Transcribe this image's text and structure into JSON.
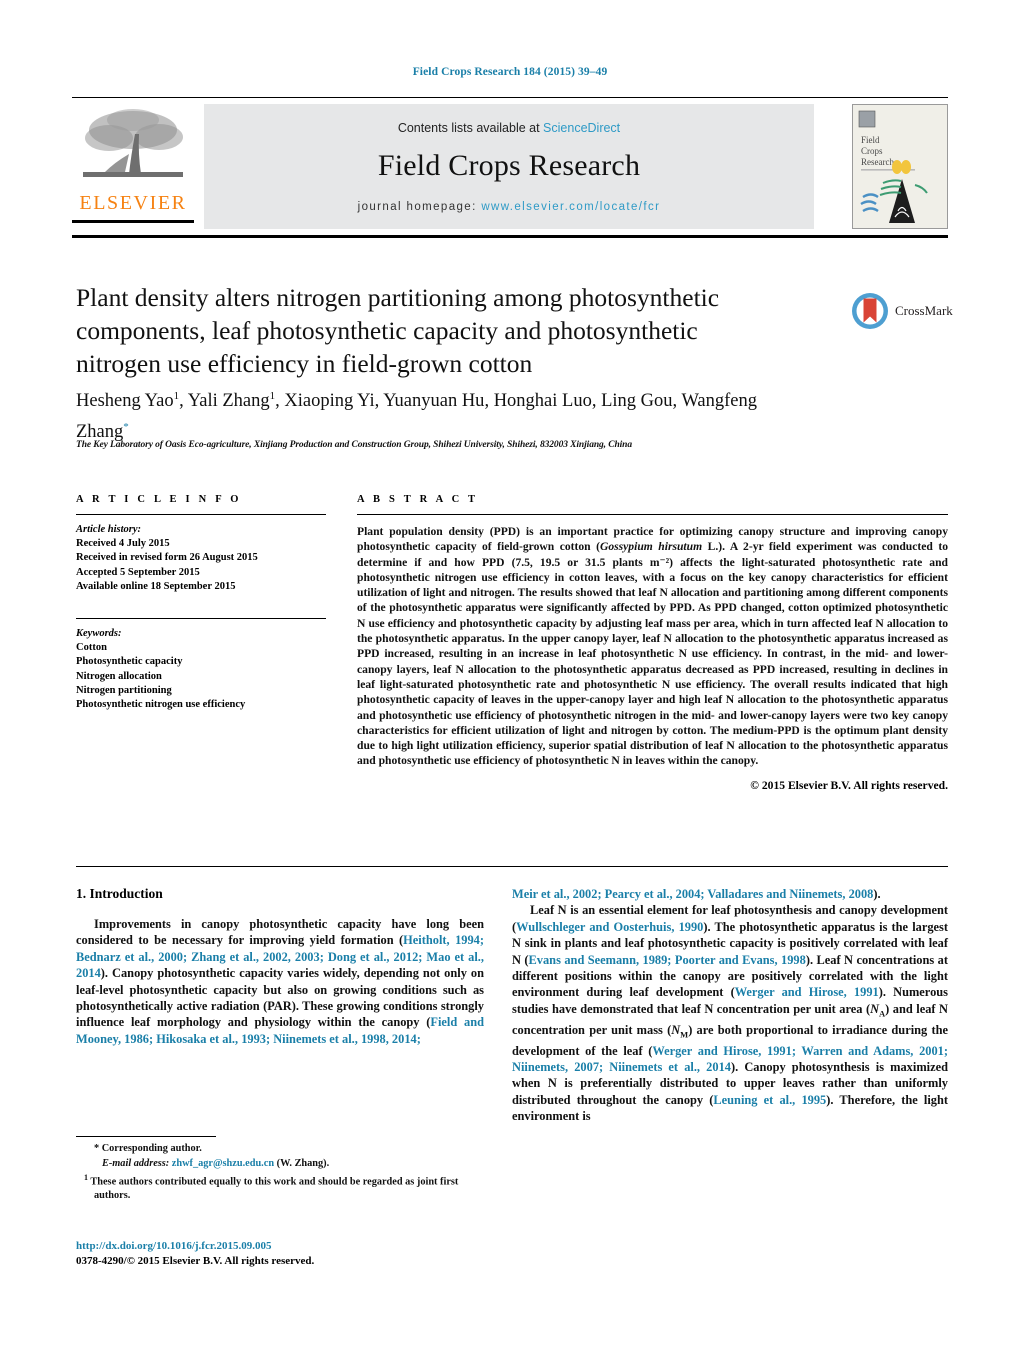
{
  "running_head": "Field Crops Research 184 (2015) 39–49",
  "masthead": {
    "contents_prefix": "Contents lists available at ",
    "sciencedirect": "ScienceDirect",
    "journal_title": "Field Crops Research",
    "homepage_prefix": "journal homepage: ",
    "homepage_url": "www.elsevier.com/locate/fcr",
    "publisher_wordmark": "ELSEVIER",
    "publisher_logo_icon": "elsevier-tree-icon",
    "cover_icon": "journal-cover-thumbnail",
    "cover_title_lines": [
      "Field",
      "Crops",
      "Research"
    ]
  },
  "article": {
    "title": "Plant density alters nitrogen partitioning among photosynthetic components, leaf photosynthetic capacity and photosynthetic nitrogen use efficiency in field-grown cotton",
    "authors": "Hesheng Yao¹, Yali Zhang¹, Xiaoping Yi, Yuanyuan Hu, Honghai Luo, Ling Gou, Wangfeng Zhang*",
    "affiliation": "The Key Laboratory of Oasis Eco-agriculture, Xinjiang Production and Construction Group, Shihezi University, Shihezi, 832003 Xinjiang, China",
    "crossmark_label": "CrossMark",
    "crossmark_icon": "crossmark-icon"
  },
  "article_info": {
    "heading": "A R T I C L E   I N F O",
    "history_heading": "Article history:",
    "history": [
      "Received 4 July 2015",
      "Received in revised form 26 August 2015",
      "Accepted 5 September 2015",
      "Available online 18 September 2015"
    ],
    "keywords_heading": "Keywords:",
    "keywords": [
      "Cotton",
      "Photosynthetic capacity",
      "Nitrogen allocation",
      "Nitrogen partitioning",
      "Photosynthetic nitrogen use efficiency"
    ]
  },
  "abstract": {
    "heading": "A B S T R A C T",
    "part1": "Plant population density (PPD) is an important practice for optimizing canopy structure and improving canopy photosynthetic capacity of field-grown cotton (",
    "species": "Gossypium hirsutum",
    "part2": " L.). A 2-yr field experiment was conducted to determine if and how PPD (7.5, 19.5 or 31.5 plants m⁻²) affects the light-saturated photosynthetic rate and photosynthetic nitrogen use efficiency in cotton leaves, with a focus on the key canopy characteristics for efficient utilization of light and nitrogen. The results showed that leaf N allocation and partitioning among different components of the photosynthetic apparatus were significantly affected by PPD. As PPD changed, cotton optimized photosynthetic N use efficiency and photosynthetic capacity by adjusting leaf mass per area, which in turn affected leaf N allocation to the photosynthetic apparatus. In the upper canopy layer, leaf N allocation to the photosynthetic apparatus increased as PPD increased, resulting in an increase in leaf photosynthetic N use efficiency. In contrast, in the mid- and lower-canopy layers, leaf N allocation to the photosynthetic apparatus decreased as PPD increased, resulting in declines in leaf light-saturated photosynthetic rate and photosynthetic N use efficiency. The overall results indicated that high photosynthetic capacity of leaves in the upper-canopy layer and high leaf N allocation to the photosynthetic apparatus and photosynthetic use efficiency of photosynthetic nitrogen in the mid- and lower-canopy layers were two key canopy characteristics for efficient utilization of light and nitrogen by cotton. The medium-PPD is the optimum plant density due to high light utilization efficiency, superior spatial distribution of leaf N allocation to the photosynthetic apparatus and photosynthetic use efficiency of photosynthetic N in leaves within the canopy.",
    "copyright": "© 2015 Elsevier B.V. All rights reserved."
  },
  "introduction": {
    "heading": "1.  Introduction",
    "left_p1_a": "Improvements in canopy photosynthetic capacity have long been considered to be necessary for improving yield formation (",
    "left_p1_cite1": "Heitholt, 1994; Bednarz et al., 2000; Zhang et al., 2002, 2003; Dong et al., 2012; Mao et al., 2014",
    "left_p1_b": "). Canopy photosynthetic capacity varies widely, depending not only on leaf-level photosynthetic capacity but also on growing conditions such as photosynthetically active radiation (PAR). These growing conditions strongly influence leaf morphology and physiology within the canopy (",
    "left_p1_cite2": "Field and Mooney, 1986; Hikosaka et al., 1993; Niinemets et al., 1998, 2014;",
    "right_cite_cont": "Meir et al., 2002; Pearcy et al., 2004; Valladares and Niinemets, 2008",
    "right_cite_cont_end": ").",
    "right_p1_a": "Leaf N is an essential element for leaf photosynthesis and canopy development (",
    "right_cite_a": "Wullschleger and Oosterhuis, 1990",
    "right_p1_b": "). The photosynthetic apparatus is the largest N sink in plants and leaf photosynthetic capacity is positively correlated with leaf N (",
    "right_cite_b": "Evans and Seemann, 1989; Poorter and Evans, 1998",
    "right_p1_c": "). Leaf N concentrations at different positions within the canopy are positively correlated with the light environment during leaf development (",
    "right_cite_c": "Werger and Hirose, 1991",
    "right_p1_d": "). Numerous studies have demonstrated that leaf N concentration per unit area (",
    "na_symbol": "N",
    "na_sub": "A",
    "right_p1_e": ") and leaf N concentration per unit mass (",
    "nm_symbol": "N",
    "nm_sub": "M",
    "right_p1_f": ") are both proportional to irradiance during the development of the leaf (",
    "right_cite_d": "Werger and Hirose, 1991; Warren and Adams, 2001; Niinemets, 2007; Niinemets et al., 2014",
    "right_p1_g": "). Canopy photosynthesis is maximized when N is preferentially distributed to upper leaves rather than uniformly distributed throughout the canopy (",
    "right_cite_e": "Leuning et al., 1995",
    "right_p1_h": "). Therefore, the light environment is"
  },
  "footnotes": {
    "corresponding": "* Corresponding author.",
    "email_label": "E-mail address:",
    "email": "zhwf_agr@shzu.edu.cn",
    "email_suffix": " (W. Zhang).",
    "equal_contrib_mark": "1",
    "equal_contrib": "These authors contributed equally to this work and should be regarded as joint first authors.",
    "doi": "http://dx.doi.org/10.1016/j.fcr.2015.09.005",
    "issn_line": "0378-4290/© 2015 Elsevier B.V. All rights reserved."
  },
  "colors": {
    "link": "#1a7fa8",
    "sciencedirect": "#2e9ac6",
    "elsevier_orange": "#f68212",
    "band_gray": "#e6e7e8"
  }
}
